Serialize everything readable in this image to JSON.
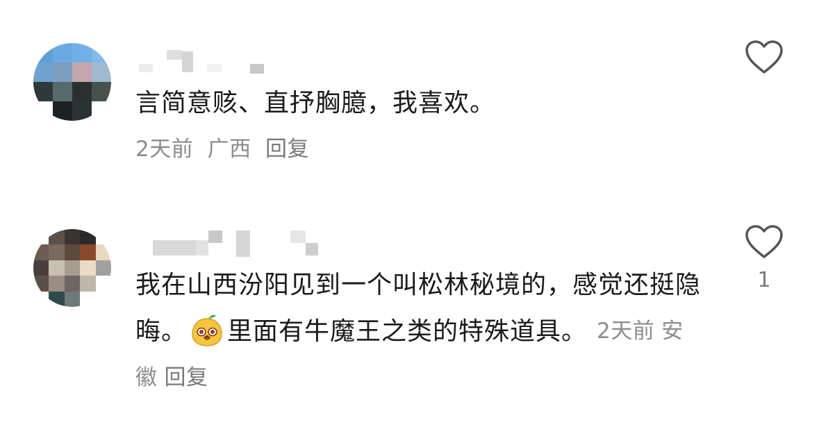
{
  "comments": [
    {
      "text": "言简意赅、直抒胸臆，我喜欢。",
      "time": "2天前",
      "location": "广西",
      "reply_label": "回复",
      "like_count": ""
    },
    {
      "text_before_emoji": "我在山西汾阳见到一个叫松林秘境的，感觉还挺隐晦。",
      "emoji": "mango-face-emoji",
      "text_after_emoji": "里面有牛魔王之类的特殊道具。",
      "time": "2天前",
      "location": "安徽",
      "reply_label": "回复",
      "like_count": "1"
    }
  ],
  "colors": {
    "text": "#1a1a1a",
    "meta": "#8c8c8c",
    "icon": "#555555"
  },
  "icons": {
    "like": "heart-outline-icon"
  }
}
